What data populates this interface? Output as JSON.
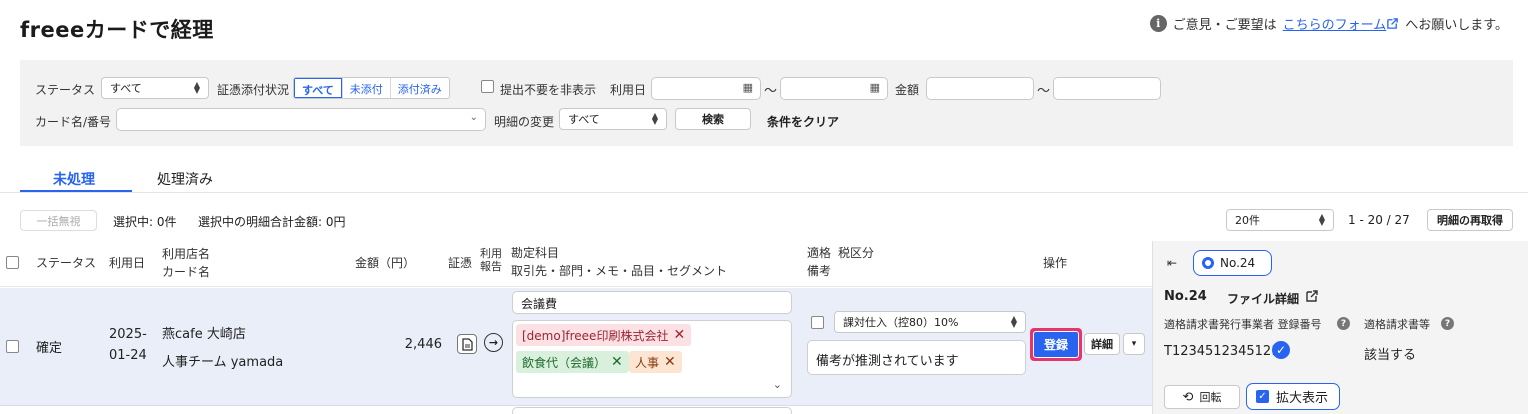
{
  "header": {
    "title": "freeeカードで経理",
    "feedback_prefix": "ご意見・ご要望は",
    "feedback_link": "こちらのフォーム",
    "feedback_suffix": "へお願いします。"
  },
  "filter": {
    "status_label": "ステータス",
    "status_value": "すべて",
    "evidence_label": "証憑添付状況",
    "evidence_options": [
      "すべて",
      "未添付",
      "添付済み"
    ],
    "hide_unneeded_label": "提出不要を非表示",
    "use_date_label": "利用日",
    "tilde": "〜",
    "amount_label": "金額",
    "card_label": "カード名/番号",
    "change_label": "明細の変更",
    "change_value": "すべて",
    "search_button": "検索",
    "clear_button": "条件をクリア"
  },
  "tabs": [
    "未処理",
    "処理済み"
  ],
  "toolbar": {
    "ignore_button": "一括無視",
    "selected_count": "選択中: 0件",
    "selected_total": "選択中の明細合計金額: 0円",
    "per_page": "20件",
    "range": "1 - 20 / 27",
    "refetch_button": "明細の再取得"
  },
  "columns": {
    "status": "ステータス",
    "date": "利用日",
    "shop": "利用店名",
    "card": "カード名",
    "amount": "金額（円）",
    "evidence": "証憑",
    "usage_report_1": "利用",
    "usage_report_2": "報告",
    "account": "勘定科目",
    "account_sub": "取引先・部門・メモ・品目・セグメント",
    "qualified": "適格",
    "tax": "税区分",
    "remarks": "備考",
    "ops": "操作"
  },
  "row": {
    "status": "確定",
    "date_year": "2025-",
    "date_md": "01-24",
    "shop": "燕cafe 大崎店",
    "card": "人事チーム yamada",
    "amount": "2,446",
    "account": "会議費",
    "tags": [
      "[demo]freee印刷株式会社",
      "飲食代（会議）",
      "人事"
    ],
    "tax": "課対仕入（控80）10%",
    "remarks": "備考が推測されています",
    "register_button": "登録",
    "detail_button": "詳細"
  },
  "side_panel": {
    "selector": "No.24",
    "no": "No.24",
    "file_detail": "ファイル詳細",
    "issuer_label": "適格請求書発行事業者 登録番号",
    "invoice_label": "適格請求書等",
    "reg_number": "T1234512345121",
    "applicable": "該当する",
    "rotate_button": "回転",
    "zoom_label": "拡大表示"
  },
  "colors": {
    "accent": "#2864f0",
    "highlight": "#e8336e",
    "row_bg": "#e9eef8"
  }
}
